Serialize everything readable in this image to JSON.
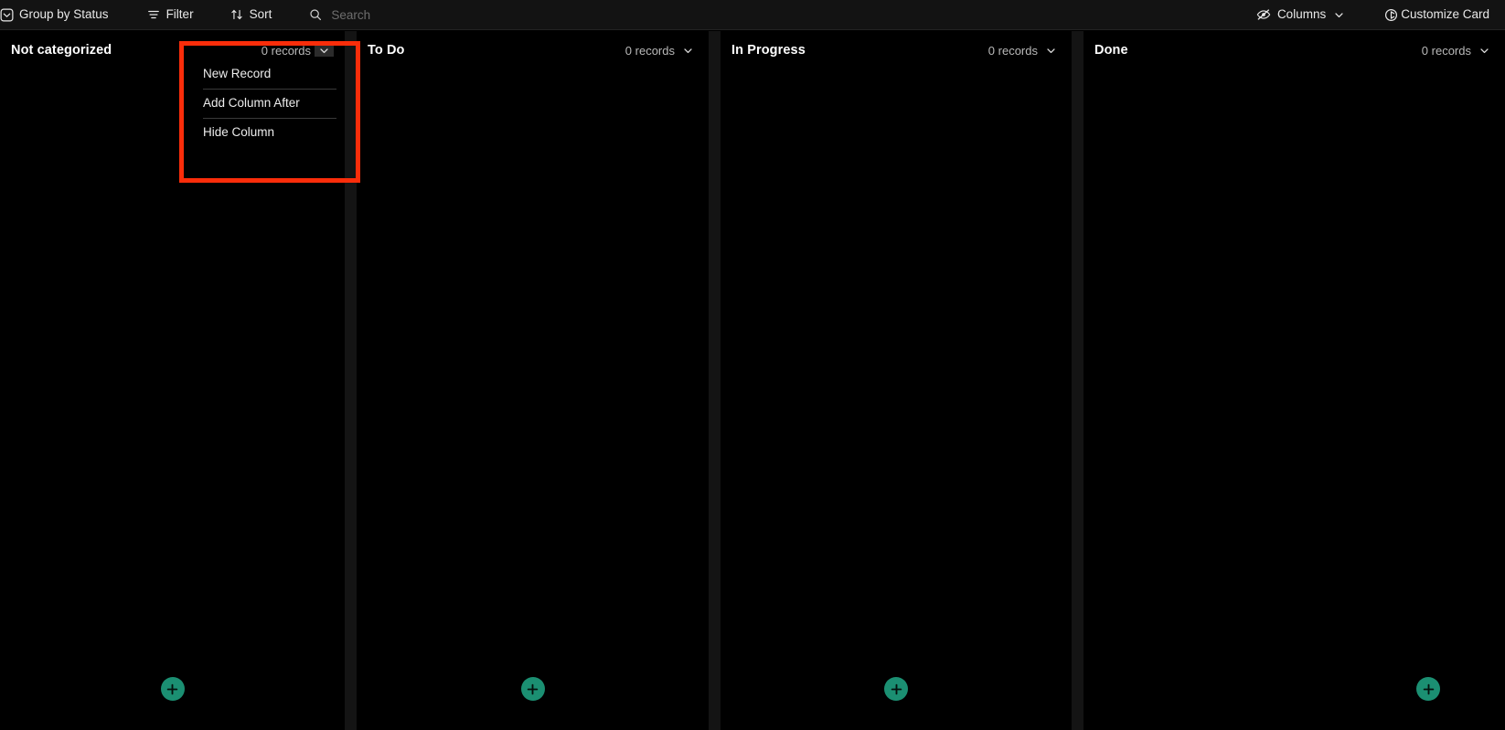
{
  "toolbar": {
    "group_by": {
      "label": "Group by Status",
      "icon": "group-by-icon"
    },
    "filter": {
      "label": "Filter",
      "icon": "filter-icon"
    },
    "sort": {
      "label": "Sort",
      "icon": "sort-icon"
    },
    "search": {
      "placeholder": "Search",
      "value": "",
      "icon": "search-icon"
    },
    "columns": {
      "label": "Columns",
      "icon": "eye-off-icon",
      "chevron": "chevron-down-icon"
    },
    "customize_card": {
      "label": "Customize Card",
      "icon": "customize-card-icon"
    }
  },
  "board": {
    "columns": [
      {
        "title": "Not categorized",
        "records": "0 records",
        "add_label": "+",
        "chevron_active": true
      },
      {
        "title": "To Do",
        "records": "0 records",
        "add_label": "+",
        "chevron_active": false
      },
      {
        "title": "In Progress",
        "records": "0 records",
        "add_label": "+",
        "chevron_active": false
      },
      {
        "title": "Done",
        "records": "0 records",
        "add_label": "+",
        "chevron_active": false
      }
    ]
  },
  "column_menu": {
    "items": [
      {
        "label": "New Record"
      },
      {
        "label": "Add Column After"
      },
      {
        "label": "Hide Column"
      }
    ]
  },
  "colors": {
    "accent_green": "#1b8f72",
    "highlight_red": "#fa2d0a",
    "toolbar_bg": "#131313",
    "board_bg": "#000000",
    "gap_bg": "#141414"
  }
}
